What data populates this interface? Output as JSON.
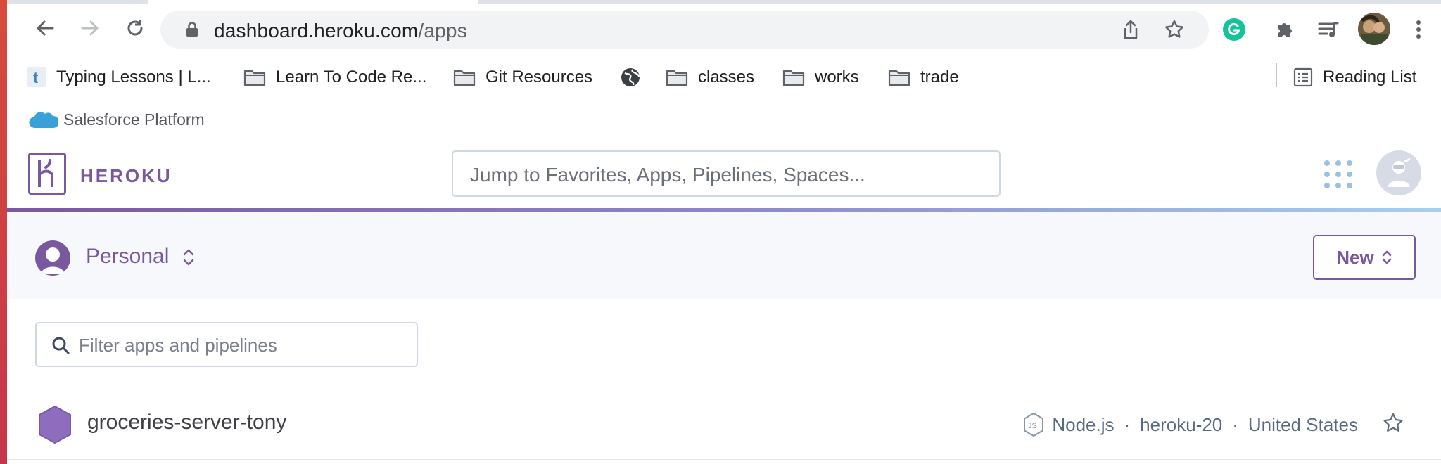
{
  "browser": {
    "url_host": "dashboard.heroku.com",
    "url_path": "/apps",
    "bookmarks": [
      {
        "label": "Typing Lessons | L...",
        "icon": "typing-favicon"
      },
      {
        "label": "Learn To Code Re...",
        "icon": "folder-icon"
      },
      {
        "label": "Git Resources",
        "icon": "folder-icon"
      },
      {
        "label": "",
        "icon": "globe-icon"
      },
      {
        "label": "classes",
        "icon": "folder-icon"
      },
      {
        "label": "works",
        "icon": "folder-icon"
      },
      {
        "label": "trade",
        "icon": "folder-icon"
      }
    ],
    "reading_list": "Reading List"
  },
  "salesforce": {
    "label": "Salesforce Platform"
  },
  "heroku": {
    "brand": "HEROKU",
    "search_placeholder": "Jump to Favorites, Apps, Pipelines, Spaces..."
  },
  "context": {
    "account": "Personal",
    "new_button": "New"
  },
  "filter": {
    "placeholder": "Filter apps and pipelines"
  },
  "apps": [
    {
      "name": "groceries-server-tony",
      "language": "Node.js",
      "stack": "heroku-20",
      "region": "United States"
    }
  ],
  "colors": {
    "heroku_purple": "#79589f",
    "meta_text": "#596981",
    "gradient_end": "#a6d0ee"
  }
}
